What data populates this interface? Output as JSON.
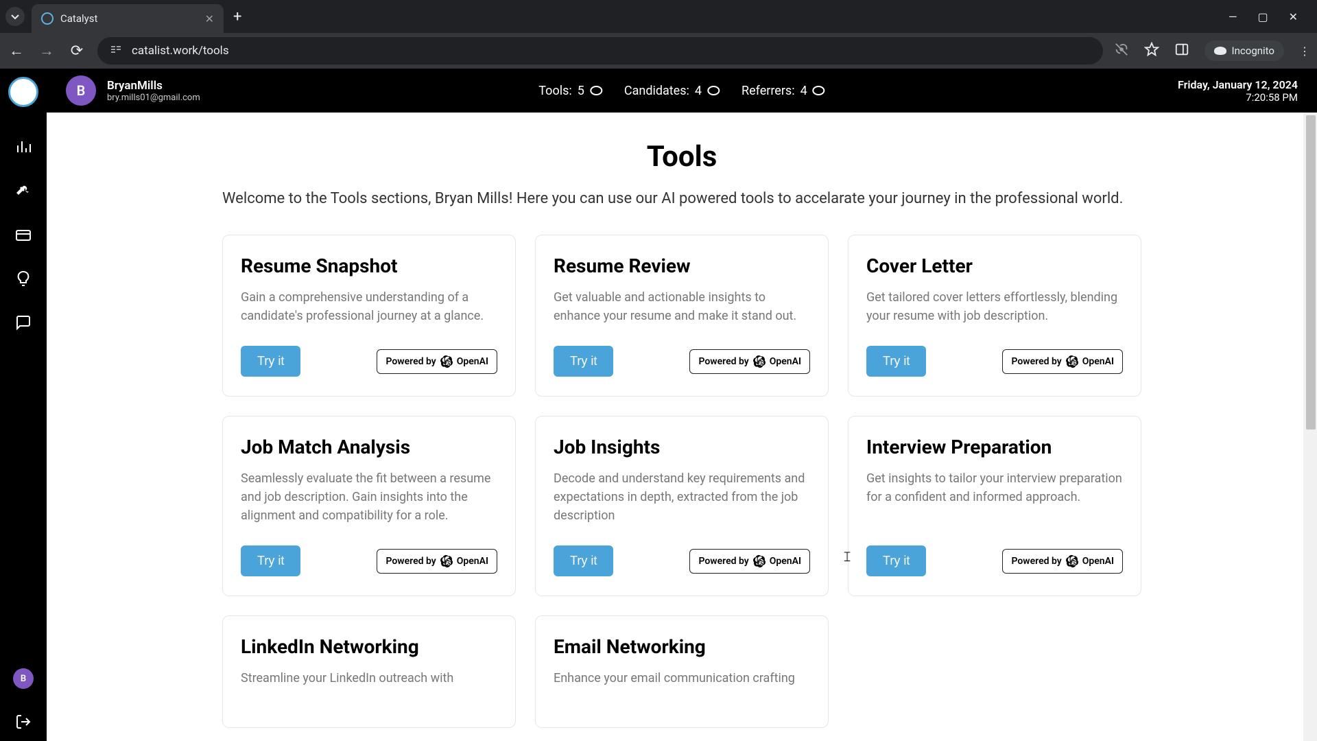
{
  "browser": {
    "tab_title": "Catalyst",
    "url": "catalist.work/tools",
    "incognito_label": "Incognito"
  },
  "header": {
    "avatar_initial": "B",
    "username": "BryanMills",
    "email": "bry.mills01@gmail.com",
    "stats": {
      "tools_label": "Tools:",
      "tools_count": "5",
      "candidates_label": "Candidates:",
      "candidates_count": "4",
      "referrers_label": "Referrers:",
      "referrers_count": "4"
    },
    "date": "Friday, January 12, 2024",
    "time": "7:20:58 PM"
  },
  "rail": {
    "avatar_initial": "B"
  },
  "page": {
    "title": "Tools",
    "subtitle": "Welcome to the Tools sections, Bryan Mills! Here you can use our AI powered tools to accelarate your journey in the professional world."
  },
  "card_common": {
    "try_label": "Try it",
    "powered_prefix": "Powered by",
    "powered_brand": "OpenAI"
  },
  "cards": [
    {
      "title": "Resume Snapshot",
      "desc": "Gain a comprehensive understanding of a candidate's professional journey at a glance."
    },
    {
      "title": "Resume Review",
      "desc": "Get valuable and actionable insights to enhance your resume and make it stand out."
    },
    {
      "title": "Cover Letter",
      "desc": "Get tailored cover letters effortlessly, blending your resume with job description."
    },
    {
      "title": "Job Match Analysis",
      "desc": "Seamlessly evaluate the fit between a resume and job description. Gain insights into the alignment and compatibility for a role."
    },
    {
      "title": "Job Insights",
      "desc": "Decode and understand key requirements and expectations in depth, extracted from the job description"
    },
    {
      "title": "Interview Preparation",
      "desc": "Get insights to tailor your interview preparation for a confident and informed approach."
    },
    {
      "title": "LinkedIn Networking",
      "desc": "Streamline your LinkedIn outreach with"
    },
    {
      "title": "Email Networking",
      "desc": "Enhance your email communication crafting"
    }
  ]
}
